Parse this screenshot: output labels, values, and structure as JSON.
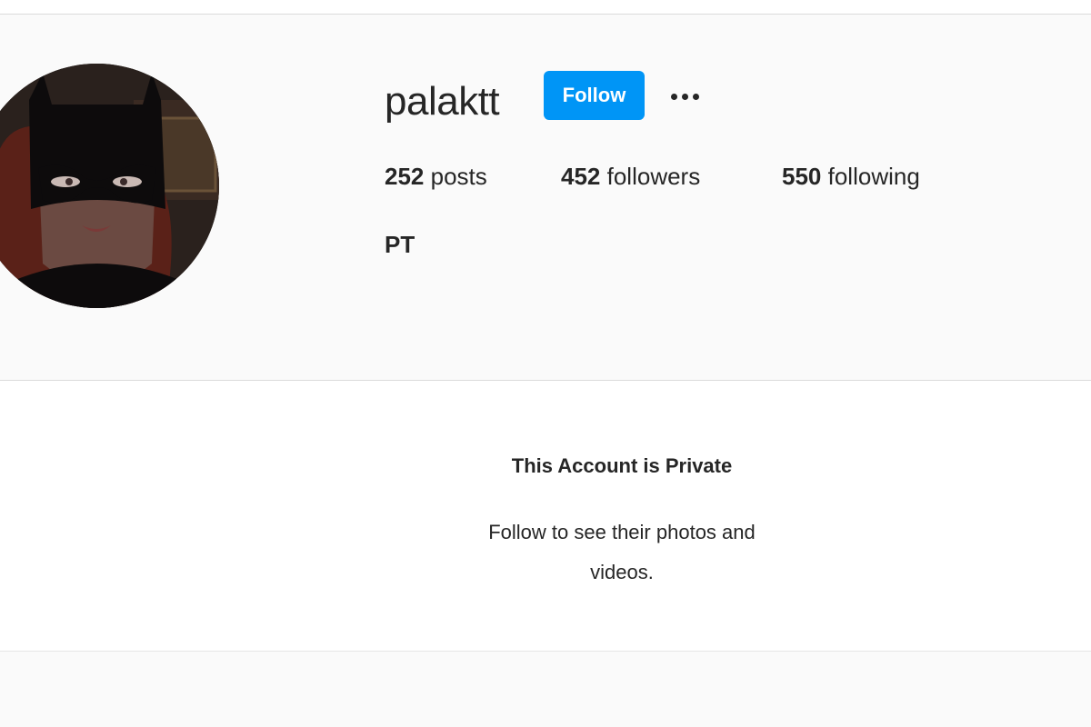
{
  "profile": {
    "username": "palaktt",
    "follow_label": "Follow",
    "more_options_icon": "more-horizontal-icon",
    "avatar_description": "cartoon profile picture",
    "stats": {
      "posts_count": "252",
      "posts_label": "posts",
      "followers_count": "452",
      "followers_label": "followers",
      "following_count": "550",
      "following_label": "following"
    },
    "full_name": "PT"
  },
  "private_notice": {
    "title": "This Account is Private",
    "line1": "Follow to see their photos and",
    "line2": "videos."
  },
  "colors": {
    "accent": "#0095f6",
    "text": "#262626",
    "header_bg": "#fafafa",
    "border": "#dbdbdb"
  }
}
